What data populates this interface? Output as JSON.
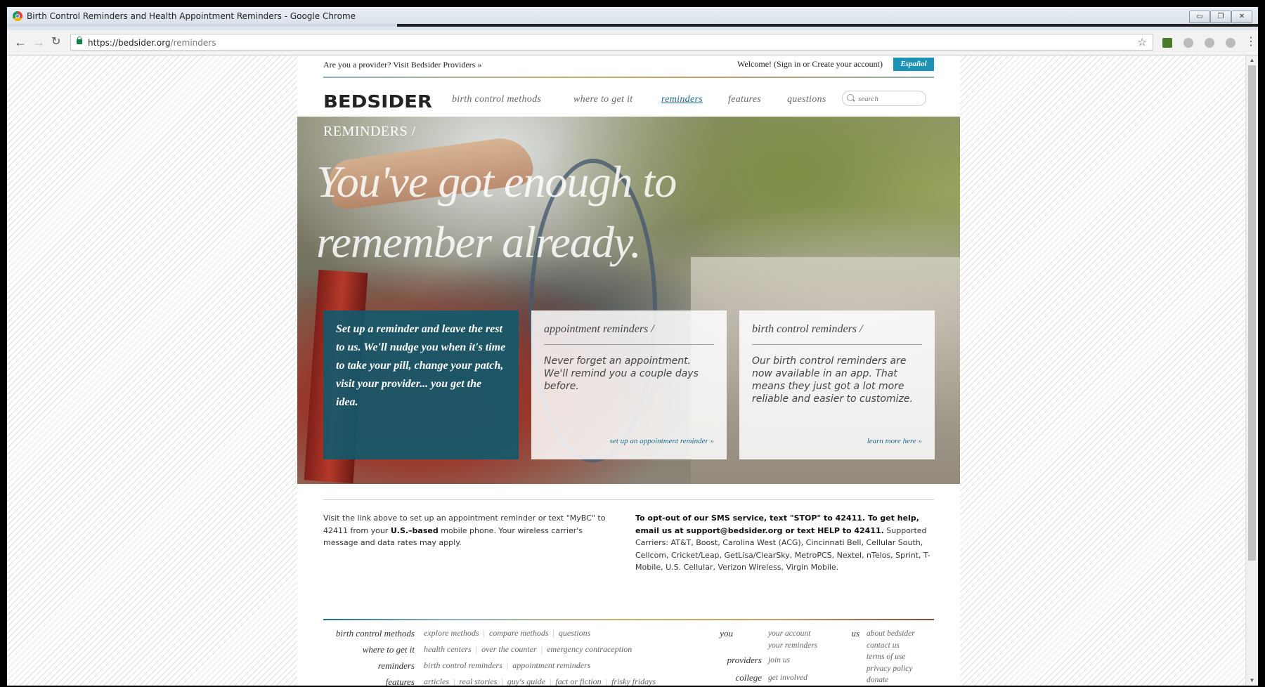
{
  "window": {
    "title": "Birth Control Reminders and Health Appointment Reminders - Google Chrome"
  },
  "browser": {
    "url_host": "https://bedsider.org",
    "url_path": "/reminders"
  },
  "site": {
    "provider_link": "Are you a provider? Visit Bedsider Providers »",
    "welcome": "Welcome! (Sign in or Create your account)",
    "espanol": "Español",
    "logo": "BEDSIDER",
    "nav": [
      "birth control methods",
      "where to get it",
      "reminders",
      "features",
      "questions"
    ],
    "search_placeholder": "search"
  },
  "hero": {
    "section": "REMINDERS /",
    "headline": "You've got enough to remember already.",
    "intro": "Set up a reminder and leave the rest to us. We'll nudge you when it's time to take your pill, change your patch, visit your provider... you get the idea.",
    "cards": [
      {
        "title": "appointment reminders /",
        "body": "Never forget an appointment. We'll remind you a couple days before.",
        "link": "set up an appointment reminder »"
      },
      {
        "title": "birth control reminders /",
        "body": "Our birth control reminders are now available in an app. That means they just got a lot more reliable and easier to customize.",
        "link": "learn more here »"
      }
    ]
  },
  "info": {
    "left": {
      "part1": "Visit the link above to set up an appointment reminder or text \"MyBC\" to 42411 from your ",
      "bold": "U.S.–based",
      "part2": " mobile phone. Your wireless carrier's message and data rates may apply."
    },
    "right": {
      "bold1": "To opt-out of our SMS service, text \"STOP\" to 42411. To get help, email us at support@bedsider.org or text HELP to 42411.",
      "rest": " Supported Carriers: AT&T, Boost, Carolina West (ACG), Cincinnati Bell, Cellular South, Cellcom, Cricket/Leap, GetLisa/ClearSky, MetroPCS, Nextel, nTelos, Sprint, T-Mobile, U.S. Cellular, Verizon Wireless, Virgin Mobile."
    }
  },
  "footer": {
    "rows": [
      {
        "category": "birth control methods",
        "links": [
          "explore methods",
          "compare methods",
          "questions"
        ]
      },
      {
        "category": "where to get it",
        "links": [
          "health centers",
          "over the counter",
          "emergency contraception"
        ]
      },
      {
        "category": "reminders",
        "links": [
          "birth control reminders",
          "appointment reminders"
        ]
      },
      {
        "category": "features",
        "links": [
          "articles",
          "real stories",
          "guy's guide",
          "fact or fiction",
          "frisky fridays"
        ]
      }
    ],
    "you_label": "you",
    "you_links": [
      "your account",
      "your reminders"
    ],
    "providers_label": "providers",
    "providers_links": [
      "join us"
    ],
    "college_label": "college",
    "college_links": [
      "get involved"
    ],
    "us_label": "us",
    "us_links": [
      "about bedsider",
      "contact us",
      "terms of use",
      "privacy policy",
      "donate"
    ]
  }
}
